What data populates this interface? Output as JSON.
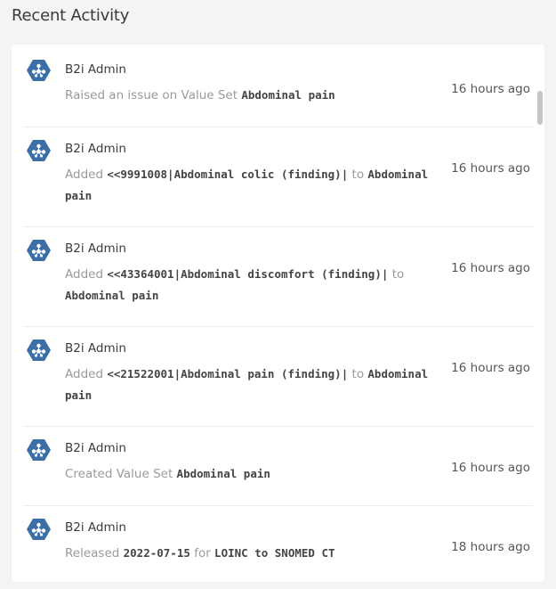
{
  "header": {
    "title": "Recent Activity"
  },
  "colors": {
    "avatar": "#3b6fa6",
    "avatar_dots": "#ffffff",
    "muted_text": "#9a9a9a"
  },
  "activities": [
    {
      "user": "B2i Admin",
      "action_text": "Raised an issue on Value Set",
      "target": "Abdominal pain",
      "time": "16 hours ago",
      "avatar_icon": "b2i-network-icon"
    },
    {
      "user": "B2i Admin",
      "action_text": "Added",
      "code": "<<9991008|Abdominal colic (finding)|",
      "connector": "to",
      "target": "Abdominal pain",
      "time": "16 hours ago",
      "avatar_icon": "b2i-network-icon"
    },
    {
      "user": "B2i Admin",
      "action_text": "Added",
      "code": "<<43364001|Abdominal discomfort (finding)|",
      "connector": "to",
      "target": "Abdominal pain",
      "time": "16 hours ago",
      "avatar_icon": "b2i-network-icon"
    },
    {
      "user": "B2i Admin",
      "action_text": "Added",
      "code": "<<21522001|Abdominal pain (finding)|",
      "connector": "to",
      "target": "Abdominal pain",
      "time": "16 hours ago",
      "avatar_icon": "b2i-network-icon"
    },
    {
      "user": "B2i Admin",
      "action_text": "Created Value Set",
      "target": "Abdominal pain",
      "time": "16 hours ago",
      "avatar_icon": "b2i-network-icon"
    },
    {
      "user": "B2i Admin",
      "action_text": "Released",
      "version": "2022-07-15",
      "connector": "for",
      "target": "LOINC to SNOMED CT",
      "time": "18 hours ago",
      "avatar_icon": "b2i-network-icon"
    }
  ]
}
